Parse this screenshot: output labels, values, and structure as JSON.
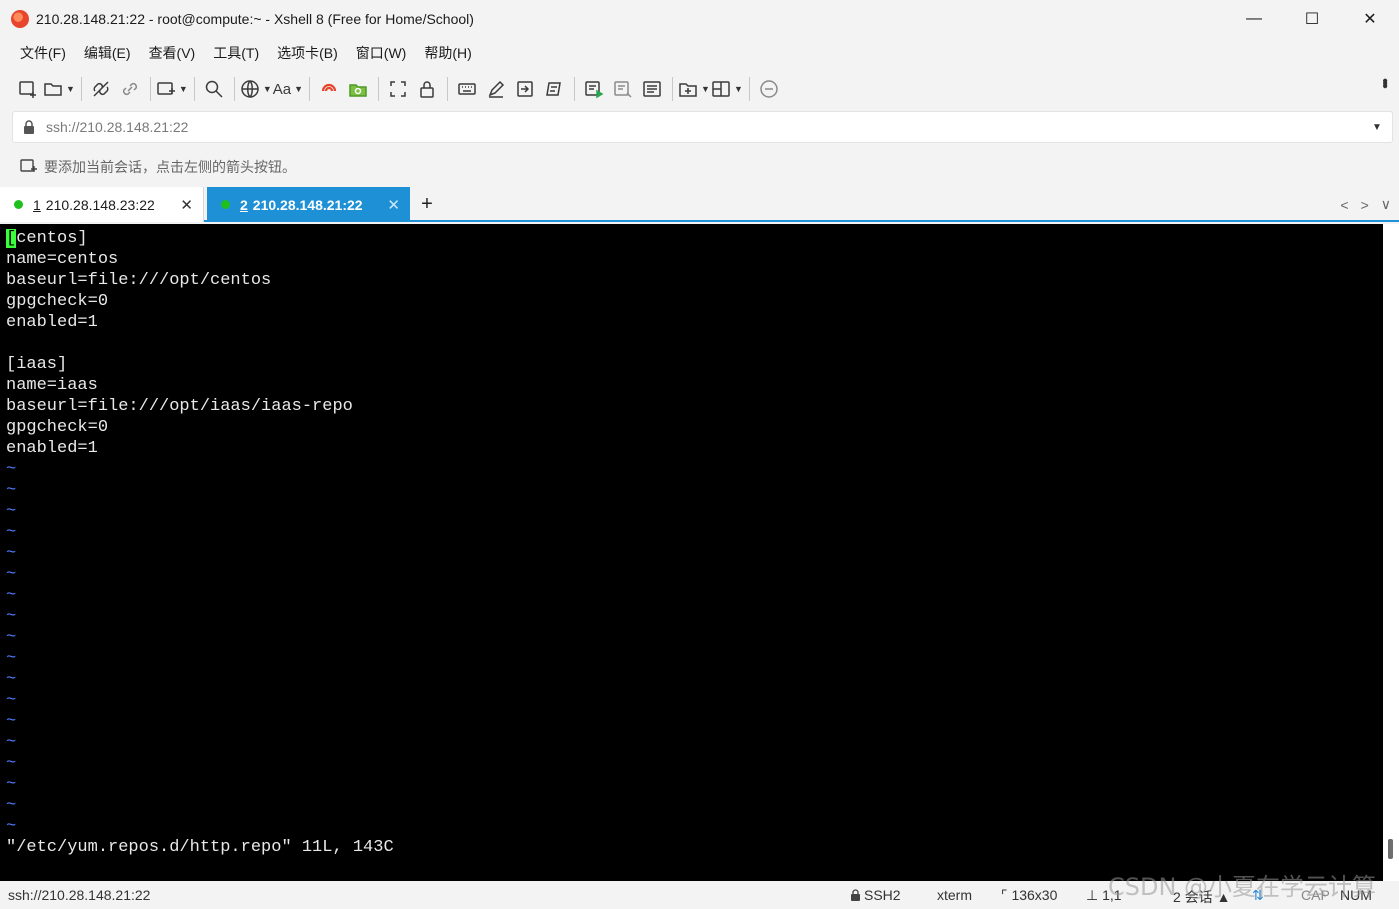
{
  "window": {
    "title": "210.28.148.21:22 - root@compute:~ - Xshell 8 (Free for Home/School)",
    "minimize_glyph": "—",
    "maximize_glyph": "☐",
    "close_glyph": "✕"
  },
  "menu": [
    "文件(F)",
    "编辑(E)",
    "查看(V)",
    "工具(T)",
    "选项卡(B)",
    "窗口(W)",
    "帮助(H)"
  ],
  "toolbar": {
    "font_button_label": "Aa",
    "icons": [
      "new-session-icon",
      "open-folder-icon",
      "disconnect-icon",
      "reconnect-icon",
      "new-window-icon",
      "search-icon",
      "globe-icon",
      "font-icon",
      "xshell-icon",
      "xftp-icon",
      "fullscreen-icon",
      "lock-icon",
      "keyboard-icon",
      "compose-icon",
      "transfer-icon",
      "script-icon",
      "send-icon",
      "log-icon",
      "notes-icon",
      "add-tab-icon",
      "layout-icon",
      "chat-icon"
    ]
  },
  "address": {
    "value": "ssh://210.28.148.21:22"
  },
  "hint": {
    "text": "要添加当前会话，点击左侧的箭头按钮。"
  },
  "tabs": [
    {
      "num": "1",
      "label": "210.28.148.23:22",
      "status_color": "#1ec01e",
      "active": false
    },
    {
      "num": "2",
      "label": "210.28.148.21:22",
      "status_color": "#1ec01e",
      "active": true
    }
  ],
  "tab_add_label": "+",
  "terminal": {
    "cursor_char": "[",
    "first_line_rest": "centos]",
    "lines": [
      "name=centos",
      "baseurl=file:///opt/centos",
      "gpgcheck=0",
      "enabled=1",
      "",
      "[iaas]",
      "name=iaas",
      "baseurl=file:///opt/iaas/iaas-repo",
      "gpgcheck=0",
      "enabled=1"
    ],
    "tilde_count": 18,
    "status_line": "\"/etc/yum.repos.d/http.repo\" 11L, 143C"
  },
  "statusbar": {
    "connection": "ssh://210.28.148.21:22",
    "protocol": "SSH2",
    "terminal_type": "xterm",
    "size": "136x30",
    "cursor_pos": "1,1",
    "sessions": "2 会话",
    "caps": "CAP",
    "num": "NUM",
    "watermark": "CSDN @小夏在学云计算"
  },
  "colors": {
    "active_tab": "#1e90d6",
    "terminal_bg": "#000000",
    "tilde": "#4f7dff",
    "cursor": "#3cff3c"
  }
}
